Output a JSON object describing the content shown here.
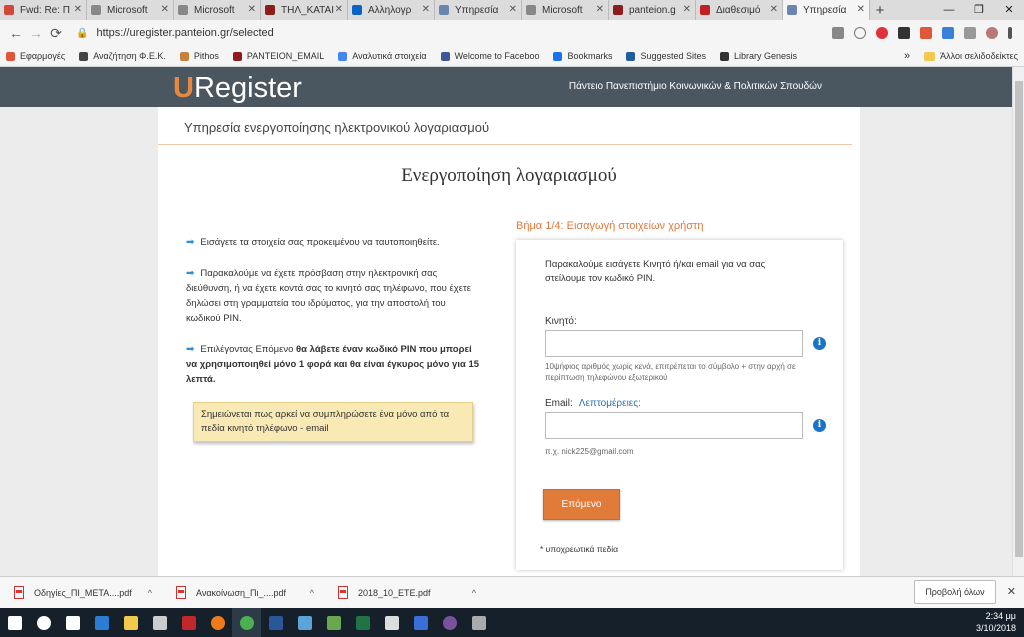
{
  "browser": {
    "tabs": [
      {
        "label": "Fwd: Re: Π",
        "color": "#d44638"
      },
      {
        "label": "Microsoft",
        "color": "#888888"
      },
      {
        "label": "Microsoft",
        "color": "#888888"
      },
      {
        "label": "ΤΗΛ_ΚΑΤΑΙ",
        "color": "#8b1d1d"
      },
      {
        "label": "Αλληλογρ",
        "color": "#0a64c8"
      },
      {
        "label": "Υπηρεσία",
        "color": "#6a86b0"
      },
      {
        "label": "Microsoft",
        "color": "#888888"
      },
      {
        "label": "panteion.g",
        "color": "#8b1d1d"
      },
      {
        "label": "Διαθεσιμό",
        "color": "#c42020"
      },
      {
        "label": "Υπηρεσία",
        "color": "#6a86b0"
      }
    ],
    "new_tab": "+",
    "window_controls": {
      "minimize": "—",
      "maximize": "❐",
      "close": "✕"
    },
    "url": "https://uregister.panteion.gr/selected",
    "bookmarks": [
      {
        "label": "Εφαρμογές",
        "color": "#e0583a"
      },
      {
        "label": "Αναζήτηση Φ.Ε.Κ.",
        "color": "#444444"
      },
      {
        "label": "Pithos",
        "color": "#c8813a"
      },
      {
        "label": "PANTEION_EMAIL",
        "color": "#8b1d1d"
      },
      {
        "label": "Αναλυτικά στοιχεία",
        "color": "#4285f4"
      },
      {
        "label": "Welcome to Faceboo",
        "color": "#3b5998"
      },
      {
        "label": "Bookmarks",
        "color": "#1a73e8"
      },
      {
        "label": "Suggested Sites",
        "color": "#1f5e9e"
      },
      {
        "label": "Library Genesis",
        "color": "#333333"
      }
    ],
    "bookmarks_more": "»",
    "other_bookmarks": "Άλλοι σελιδοδείκτες"
  },
  "site": {
    "logo_u": "U",
    "logo_rest": "Register",
    "university": "Πάντειο Πανεπιστήμιο Κοινωνικών & Πολιτικών Σπουδών",
    "subtitle": "Υπηρεσία ενεργοποίησης ηλεκτρονικού λογαριασμού",
    "title": "Ενεργοποίηση λογαριασμού",
    "info": {
      "p1": "Εισάγετε τα στοιχεία σας προκειμένου να ταυτοποιηθείτε.",
      "p2": "Παρακαλούμε να έχετε πρόσβαση στην ηλεκτρονική σας διεύθυνση, ή να έχετε κοντά σας το κινητό σας τηλέφωνο, που έχετε δηλώσει στη γραμματεία του ιδρύματος, για την αποστολή του κωδικού PIN.",
      "p3_start": "Επιλέγοντας Επόμενο ",
      "p3_bold": "θα λάβετε έναν κωδικό PIN που μπορεί να χρησιμοποιηθεί μόνο 1 φορά και θα είναι έγκυρος μόνο για 15 λεπτά."
    },
    "note": "Σημειώνεται πως αρκεί να συμπληρώσετε ένα μόνο από τα πεδία κινητό τηλέφωνο - email",
    "step": "Βήμα 1/4: Εισαγωγή στοιχείων χρήστη",
    "form": {
      "intro": "Παρακαλούμε εισάγετε Κινητό ή/και email για να σας στείλουμε τον κωδικό PIN.",
      "mobile_label": "Κινητό:",
      "mobile_value": "",
      "mobile_help": "10ψήφιος αριθμός χωρίς κενά, επιτρέπεται το σύμβολο + στην αρχή σε περίπτωση τηλεφώνου εξωτερικού",
      "email_label": "Email:",
      "details_link": "Λεπτομέρειες:",
      "email_value": "",
      "email_help": "π.χ. nick225@gmail.com",
      "info_glyph": "i",
      "next_button": "Επόμενο",
      "required_note": "* υποχρεωτικά πεδία"
    }
  },
  "downloads": {
    "items": [
      {
        "label": "Οδηγίες_ΠΙ_ΜΕΤΑ....pdf"
      },
      {
        "label": "Ανακοίνωση_Πι_....pdf"
      },
      {
        "label": "2018_10_ΕΤΕ.pdf"
      }
    ],
    "show_all": "Προβολή όλων",
    "close": "✕"
  },
  "taskbar": {
    "time": "2:34 μμ",
    "date": "3/10/2018",
    "apps": [
      {
        "name": "start",
        "color": "#ffffff"
      },
      {
        "name": "search",
        "color": "#ffffff"
      },
      {
        "name": "task-view",
        "color": "#ffffff"
      },
      {
        "name": "edge",
        "color": "#2b7cd3"
      },
      {
        "name": "explorer",
        "color": "#f2c94c"
      },
      {
        "name": "calculator",
        "color": "#cccccc"
      },
      {
        "name": "filezilla",
        "color": "#c0282b"
      },
      {
        "name": "firefox",
        "color": "#f07a1a"
      },
      {
        "name": "chrome",
        "color": "#4caf50"
      },
      {
        "name": "word",
        "color": "#2b579a"
      },
      {
        "name": "files",
        "color": "#5ba3d9"
      },
      {
        "name": "torrent",
        "color": "#6aa84f"
      },
      {
        "name": "excel",
        "color": "#217346"
      },
      {
        "name": "mail",
        "color": "#dddddd"
      },
      {
        "name": "app-blue",
        "color": "#3a6fd8"
      },
      {
        "name": "viber",
        "color": "#7b519d"
      },
      {
        "name": "app-extra",
        "color": "#aaaaaa"
      }
    ]
  }
}
